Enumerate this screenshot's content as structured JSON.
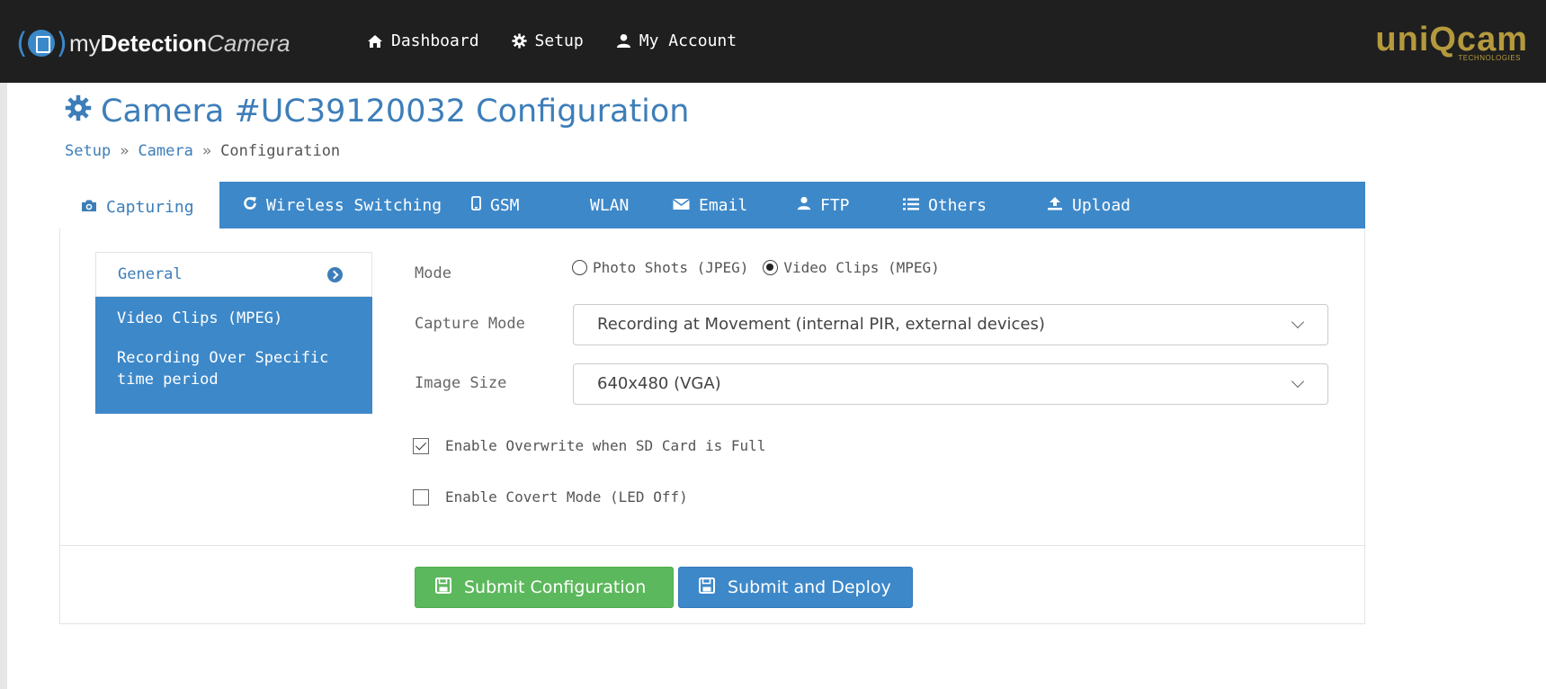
{
  "navbar": {
    "brand": {
      "part1": "my",
      "part2": "Detection",
      "part3": "Camera"
    },
    "items": [
      {
        "label": "Dashboard",
        "icon": "home-icon"
      },
      {
        "label": "Setup",
        "icon": "gear-icon"
      },
      {
        "label": "My Account",
        "icon": "user-icon"
      }
    ],
    "logo": {
      "text": "uniQcam",
      "sub": "TECHNOLOGIES"
    }
  },
  "page": {
    "title": "Camera #UC39120032 Configuration",
    "breadcrumb": [
      "Setup",
      "Camera",
      "Configuration"
    ],
    "breadcrumb_sep": "»"
  },
  "tabs": [
    {
      "label": "Capturing",
      "icon": "camera-icon",
      "active": true
    },
    {
      "label": "Wireless Switching",
      "icon": "refresh-icon"
    },
    {
      "label": "GSM",
      "icon": "mobile-icon"
    },
    {
      "label": "WLAN",
      "icon": ""
    },
    {
      "label": "Email",
      "icon": "envelope-icon"
    },
    {
      "label": "FTP",
      "icon": "user-icon"
    },
    {
      "label": "Others",
      "icon": "list-icon"
    },
    {
      "label": "Upload",
      "icon": "upload-icon"
    }
  ],
  "sidenav": [
    {
      "label": "General",
      "active": true
    },
    {
      "label": "Video Clips (MPEG)"
    },
    {
      "label": "Recording Over Specific time period"
    }
  ],
  "form": {
    "mode_label": "Mode",
    "mode_options": [
      {
        "label": "Photo Shots (JPEG)",
        "selected": false
      },
      {
        "label": "Video Clips (MPEG)",
        "selected": true
      }
    ],
    "capture_mode_label": "Capture Mode",
    "capture_mode_value": "Recording at Movement (internal PIR, external devices)",
    "image_size_label": "Image Size",
    "image_size_value": "640x480 (VGA)",
    "overwrite_label": "Enable Overwrite when SD Card is Full",
    "overwrite_checked": true,
    "covert_label": "Enable Covert Mode (LED Off)",
    "covert_checked": false
  },
  "buttons": {
    "submit": "Submit Configuration",
    "deploy": "Submit and Deploy"
  },
  "colors": {
    "primary": "#3d88c9",
    "success": "#5cb85c",
    "navbar": "#1f1f1f",
    "logo": "#b59a3d"
  }
}
